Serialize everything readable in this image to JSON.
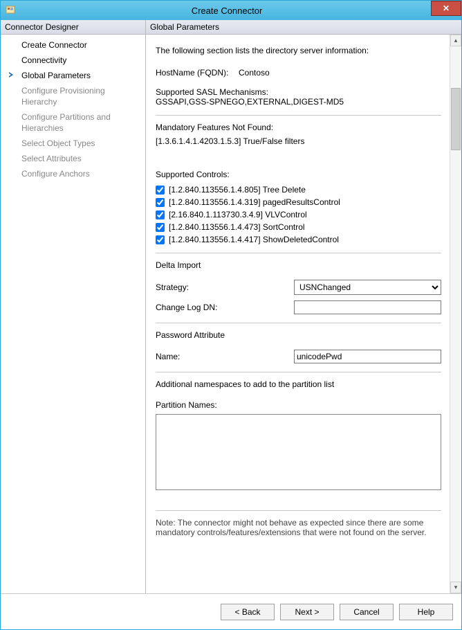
{
  "window": {
    "title": "Create Connector"
  },
  "nav": {
    "header": "Connector Designer",
    "items": [
      {
        "label": "Create Connector",
        "state": "enabled"
      },
      {
        "label": "Connectivity",
        "state": "enabled"
      },
      {
        "label": "Global Parameters",
        "state": "current"
      },
      {
        "label": "Configure Provisioning Hierarchy",
        "state": "disabled"
      },
      {
        "label": "Configure Partitions and Hierarchies",
        "state": "disabled"
      },
      {
        "label": "Select Object Types",
        "state": "disabled"
      },
      {
        "label": "Select Attributes",
        "state": "disabled"
      },
      {
        "label": "Configure Anchors",
        "state": "disabled"
      }
    ]
  },
  "main": {
    "header": "Global Parameters",
    "intro": "The following section lists the directory server information:",
    "hostname_label": "HostName (FQDN):",
    "hostname_value": "Contoso",
    "sasl_label": "Supported SASL Mechanisms:",
    "sasl_value": "GSSAPI,GSS-SPNEGO,EXTERNAL,DIGEST-MD5",
    "mandatory_label": "Mandatory Features Not Found:",
    "mandatory_value": "[1.3.6.1.4.1.4203.1.5.3] True/False filters",
    "controls_label": "Supported Controls:",
    "controls": [
      {
        "label": "[1.2.840.113556.1.4.805] Tree Delete",
        "checked": true
      },
      {
        "label": "[1.2.840.113556.1.4.319] pagedResultsControl",
        "checked": true
      },
      {
        "label": "[2.16.840.1.113730.3.4.9] VLVControl",
        "checked": true
      },
      {
        "label": "[1.2.840.113556.1.4.473] SortControl",
        "checked": true
      },
      {
        "label": "[1.2.840.113556.1.4.417] ShowDeletedControl",
        "checked": true
      }
    ],
    "delta_header": "Delta Import",
    "strategy_label": "Strategy:",
    "strategy_value": "USNChanged",
    "changelog_label": "Change Log DN:",
    "changelog_value": "",
    "pwd_header": "Password Attribute",
    "pwd_name_label": "Name:",
    "pwd_name_value": "unicodePwd",
    "ns_intro": "Additional namespaces to add to the partition list",
    "partition_label": "Partition Names:",
    "partition_value": "",
    "note": "Note: The connector might not behave as expected since there are some mandatory controls/features/extensions that were not found on the server."
  },
  "footer": {
    "back": "<  Back",
    "next": "Next  >",
    "cancel": "Cancel",
    "help": "Help"
  }
}
